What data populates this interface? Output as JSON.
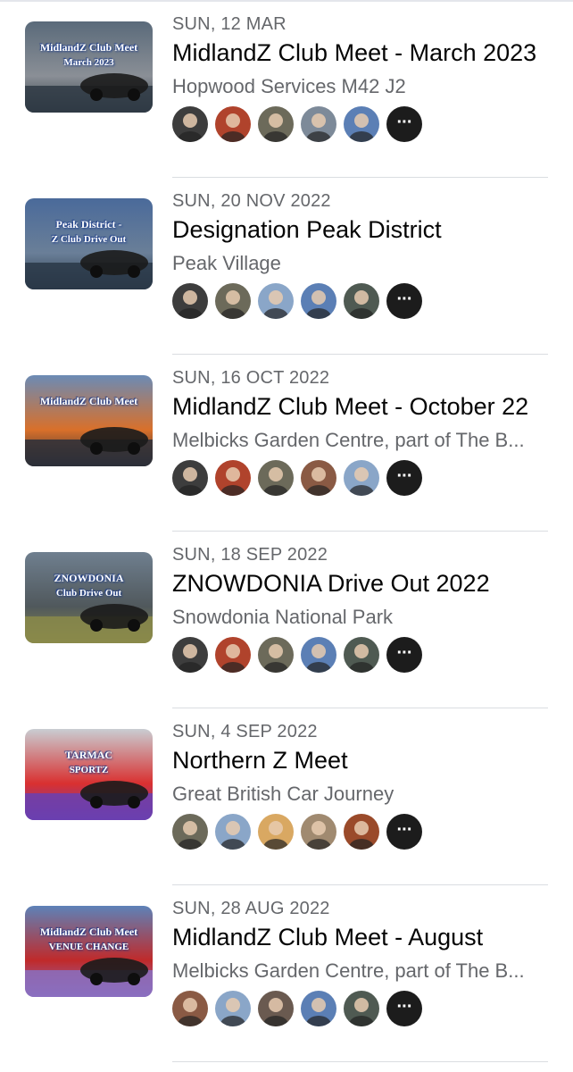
{
  "events": [
    {
      "date": "SUN, 12 MAR",
      "title": "MidlandZ Club Meet - March 2023",
      "location": "Hopwood Services M42 J2",
      "thumb_caption": [
        "MidlandZ Club Meet",
        "March 2023"
      ],
      "thumb_palette": [
        "#5a6a7a",
        "#2f3a44",
        "#8a8f96"
      ],
      "avatars": [
        "avatar-person-1",
        "avatar-person-2",
        "avatar-person-3",
        "avatar-person-4",
        "avatar-person-5"
      ],
      "avatar_colors": [
        "#3d3d3d",
        "#b0432c",
        "#6c6a5a",
        "#7d8a99",
        "#5b7fb5"
      ]
    },
    {
      "date": "SUN, 20 NOV 2022",
      "title": "Designation Peak District",
      "location": "Peak Village",
      "thumb_caption": [
        "Peak District -",
        "Z Club Drive Out"
      ],
      "thumb_palette": [
        "#4a6a9a",
        "#2a3848",
        "#6a7f98"
      ],
      "avatars": [
        "avatar-person-1",
        "avatar-person-3",
        "avatar-person-6",
        "avatar-person-5",
        "avatar-person-7"
      ],
      "avatar_colors": [
        "#3d3d3d",
        "#6c6a5a",
        "#8aa6c8",
        "#5b7fb5",
        "#4f5a52"
      ]
    },
    {
      "date": "SUN, 16 OCT 2022",
      "title": "MidlandZ Club Meet - October 22",
      "location": "Melbicks Garden Centre, part of The B...",
      "thumb_caption": [
        "MidlandZ Club Meet",
        ""
      ],
      "thumb_palette": [
        "#6b8bb5",
        "#2c2f38",
        "#d9702a"
      ],
      "avatars": [
        "avatar-person-1",
        "avatar-person-2",
        "avatar-person-3",
        "avatar-person-8",
        "avatar-person-6"
      ],
      "avatar_colors": [
        "#3d3d3d",
        "#b0432c",
        "#6c6a5a",
        "#8a5a44",
        "#8aa6c8"
      ]
    },
    {
      "date": "SUN, 18 SEP 2022",
      "title": "ZNOWDONIA Drive Out 2022",
      "location": "Snowdonia National Park",
      "thumb_caption": [
        "ZNOWDONIA",
        "Club Drive Out"
      ],
      "thumb_palette": [
        "#6f7f8f",
        "#8a8a4a",
        "#50585c"
      ],
      "avatars": [
        "avatar-person-1",
        "avatar-person-2",
        "avatar-person-3",
        "avatar-person-5",
        "avatar-person-7"
      ],
      "avatar_colors": [
        "#3d3d3d",
        "#b0432c",
        "#6c6a5a",
        "#5b7fb5",
        "#4f5a52"
      ]
    },
    {
      "date": "SUN, 4 SEP 2022",
      "title": "Northern Z Meet",
      "location": "Great British Car Journey",
      "thumb_caption": [
        "TARMAC",
        "SPORTZ"
      ],
      "thumb_palette": [
        "#c9cdd2",
        "#6a3fb0",
        "#d93030"
      ],
      "avatars": [
        "avatar-person-3",
        "avatar-person-6",
        "avatar-person-9",
        "avatar-person-10",
        "avatar-person-11"
      ],
      "avatar_colors": [
        "#6c6a5a",
        "#8aa6c8",
        "#d9a862",
        "#a08a70",
        "#9a4a2a"
      ]
    },
    {
      "date": "SUN, 28 AUG 2022",
      "title": "MidlandZ Club Meet - August",
      "location": "Melbicks Garden Centre, part of The B...",
      "thumb_caption": [
        "MidlandZ Club Meet",
        "VENUE CHANGE"
      ],
      "thumb_palette": [
        "#5d82b8",
        "#8a6fc0",
        "#c02a2a"
      ],
      "avatars": [
        "avatar-person-8",
        "avatar-person-6",
        "avatar-person-12",
        "avatar-person-5",
        "avatar-person-7"
      ],
      "avatar_colors": [
        "#8a5a44",
        "#8aa6c8",
        "#6a5a50",
        "#5b7fb5",
        "#4f5a52"
      ]
    }
  ],
  "more_label": "···"
}
